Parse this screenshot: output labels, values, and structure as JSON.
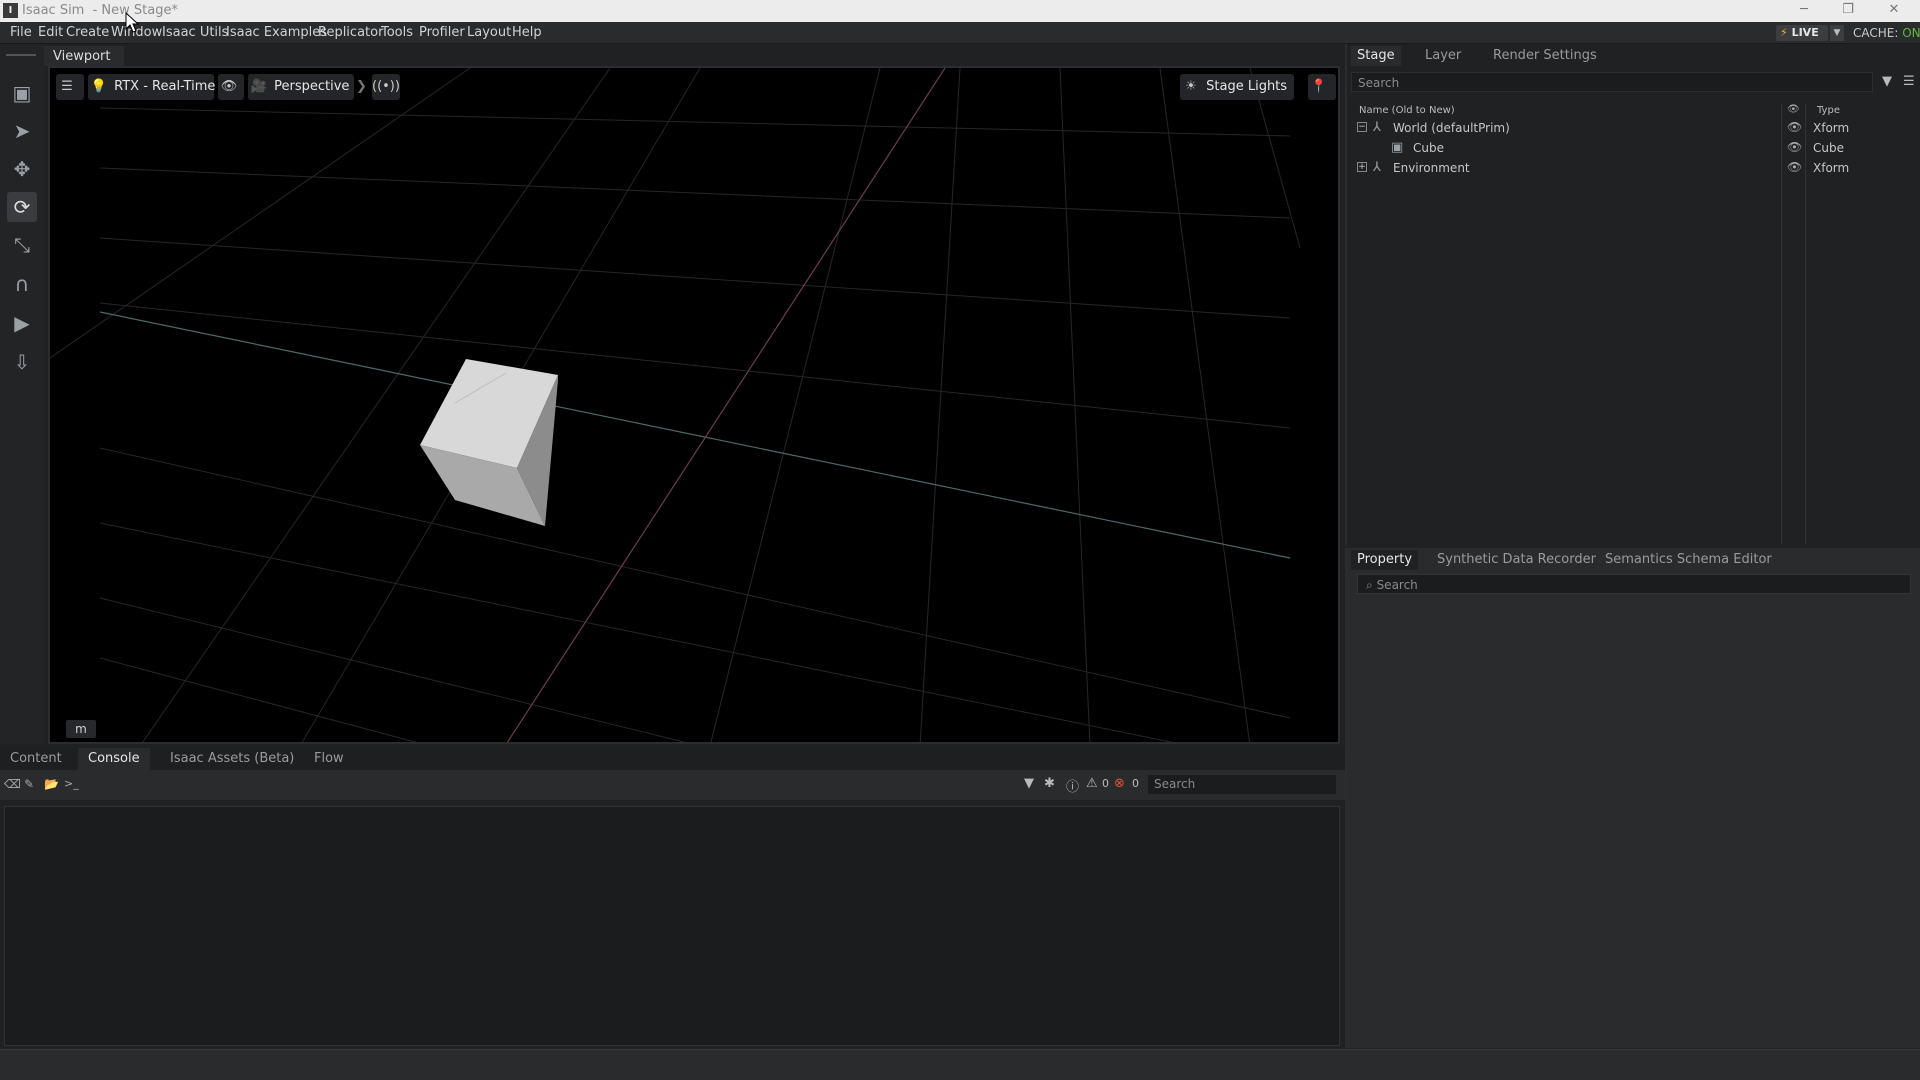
{
  "window": {
    "title": "Isaac Sim  - New Stage*"
  },
  "menu": [
    "File",
    "Edit",
    "Create",
    "Window",
    "Isaac Utils",
    "Isaac Examples",
    "Replicator",
    "Tools",
    "Profiler",
    "Layout",
    "Help"
  ],
  "topright": {
    "live_label": "LIVE",
    "cache_label": "CACHE:",
    "cache_state": "ON"
  },
  "viewport": {
    "tab_label": "Viewport",
    "renderer_label": "RTX - Real-Time",
    "camera_label": "Perspective",
    "lights_label": "Stage Lights",
    "units_label": "m"
  },
  "bottom": {
    "tabs": [
      "Content",
      "Console",
      "Isaac Assets (Beta)",
      "Flow"
    ],
    "active_tab": "Console",
    "warning_count": "0",
    "error_count": "0",
    "search_placeholder": "Search"
  },
  "stage": {
    "tabs": [
      "Stage",
      "Layer",
      "Render Settings"
    ],
    "active_tab": "Stage",
    "search_placeholder": "Search",
    "col_name": "Name (Old to New)",
    "col_type": "Type",
    "rows": [
      {
        "name": "World (defaultPrim)",
        "type": "Xform",
        "expander": "−"
      },
      {
        "name": "Cube",
        "type": "Cube",
        "expander": ""
      },
      {
        "name": "Environment",
        "type": "Xform",
        "expander": "+"
      }
    ]
  },
  "property": {
    "tabs": [
      "Property",
      "Synthetic Data Recorder",
      "Semantics Schema Editor"
    ],
    "active_tab": "Property",
    "search_placeholder": "Search"
  },
  "colors": {
    "accent_live": "#f0b030",
    "cache_on": "#62b847",
    "error": "#e0533c"
  }
}
